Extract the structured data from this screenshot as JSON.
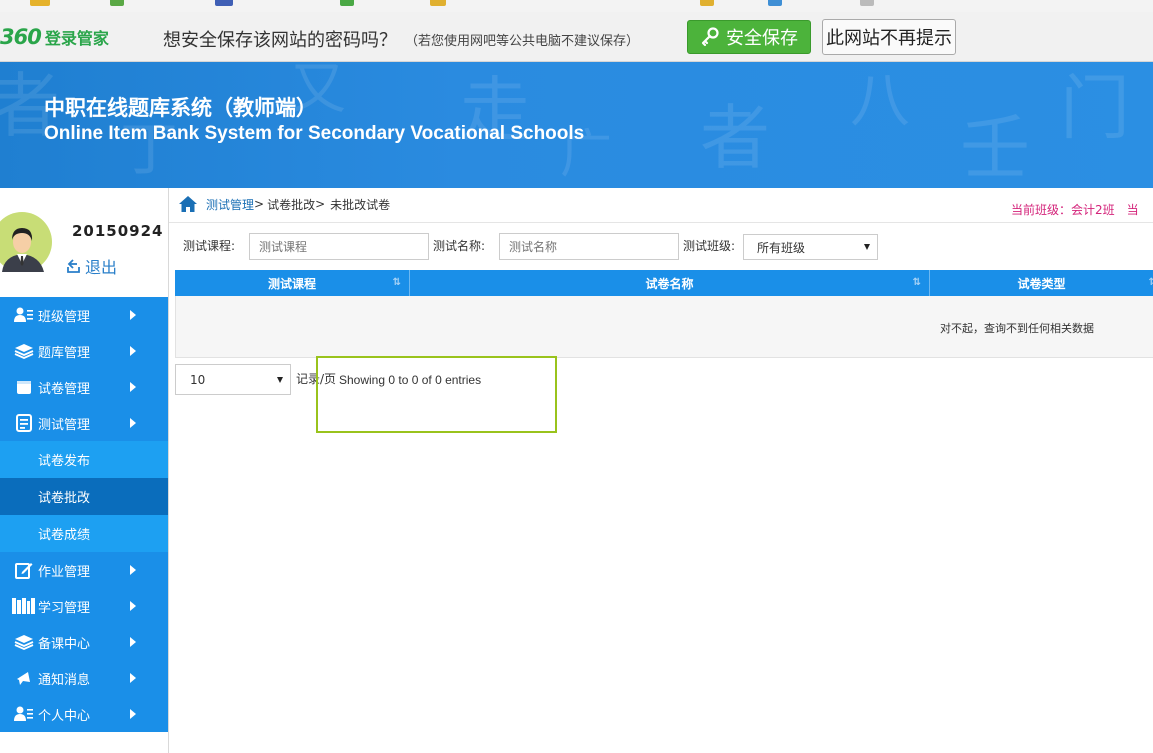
{
  "password_bar": {
    "logo_number": "360",
    "logo_text": "登录管家",
    "question": "想安全保存该网站的密码吗？",
    "note": "（若您使用网吧等公共电脑不建议保存）",
    "save_button": "安全保存",
    "never_button": "此网站不再提示"
  },
  "banner": {
    "title_cn": "中职在线题库系统（教师端）",
    "title_en": "Online Item Bank System for Secondary Vocational Schools"
  },
  "profile": {
    "username": "20150924",
    "logout": "退出"
  },
  "menu": [
    {
      "label": "班级管理",
      "icon": "user-list-icon"
    },
    {
      "label": "题库管理",
      "icon": "layers-icon"
    },
    {
      "label": "试卷管理",
      "icon": "paper-icon"
    },
    {
      "label": "测试管理",
      "icon": "document-icon"
    }
  ],
  "submenu": [
    {
      "label": "试卷发布"
    },
    {
      "label": "试卷批改"
    },
    {
      "label": "试卷成绩"
    }
  ],
  "menu_after": [
    {
      "label": "作业管理",
      "icon": "edit-icon"
    },
    {
      "label": "学习管理",
      "icon": "books-icon"
    },
    {
      "label": "备课中心",
      "icon": "layers-icon"
    },
    {
      "label": "通知消息",
      "icon": "bell-icon"
    },
    {
      "label": "个人中心",
      "icon": "user-list-icon"
    }
  ],
  "breadcrumb": {
    "level1": "测试管理",
    "sep1": ">",
    "level2": "试卷批改",
    "sep2": ">",
    "level3": "未批改试卷"
  },
  "current_class": "当前班级：会计2班",
  "current_class_extra": "当",
  "filters": {
    "course_label": "测试课程:",
    "course_placeholder": "测试课程",
    "name_label": "测试名称:",
    "name_placeholder": "测试名称",
    "class_label": "测试班级:",
    "class_selected": "所有班级"
  },
  "table": {
    "columns": [
      "测试课程",
      "试卷名称",
      "试卷类型"
    ],
    "sort_glyph": "⇅",
    "empty_message": "对不起，查询不到任何相关数据"
  },
  "pager": {
    "page_length": "10",
    "per_page_label": "记录/页",
    "info": "Showing 0 to 0 of 0 entries"
  },
  "colors": {
    "sidebar": "#1a8fe8",
    "submenu": "#1da0f2",
    "submenu_active": "#0a6dbc",
    "accent_pink": "#d4237a",
    "save_green": "#4cb33b",
    "highlight_box": "#99c31c"
  }
}
